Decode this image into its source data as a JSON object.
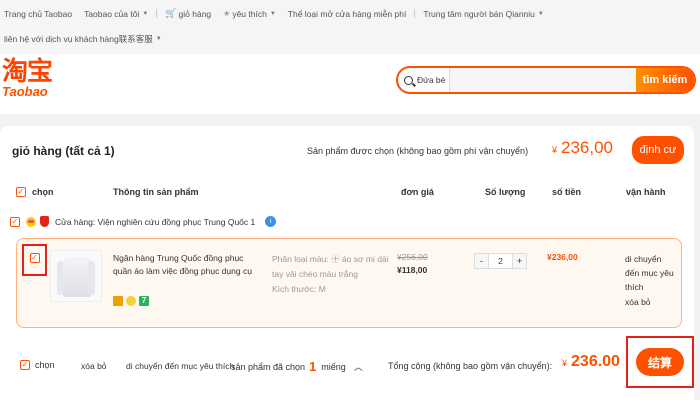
{
  "nav": {
    "row1": [
      {
        "label": "Trang chủ Taobao",
        "caret": false
      },
      {
        "label": "Taobao của tôi",
        "caret": true
      },
      {
        "label": "giỏ hàng",
        "caret": false,
        "icon": "cart-icon"
      },
      {
        "label": "yêu thích",
        "caret": true,
        "icon": "star-icon"
      },
      {
        "label": "Thể loại mở cửa hàng miễn phí",
        "caret": false
      },
      {
        "label": "Trung tâm người bán Qianniu",
        "caret": true
      }
    ],
    "row2": [
      {
        "label": "liên hệ với dịch vụ khách hàng联系客服",
        "caret": true
      }
    ]
  },
  "logo": {
    "cn": "淘宝",
    "en": "Taobao"
  },
  "search": {
    "category": "Đứa bé",
    "button": "tìm kiếm",
    "value": ""
  },
  "cart": {
    "title": "giỏ hàng (tất cả 1)",
    "selected_label": "Sản phẩm được chọn (không bao gồm phí vận chuyển)",
    "currency": "¥",
    "selected_total": "236,00",
    "checkout_top": "định cư",
    "columns": [
      "chọn",
      "Thông tin sản phẩm",
      "đơn giá",
      "Số lượng",
      "số tiền",
      "vận hành"
    ],
    "store": "Cửa hàng: Viện nghiên cứu đồng phục Trung Quốc 1",
    "item": {
      "name": "Ngân hàng Trung Quốc đồng phục quần áo làm việc đồng phục dụng cụ",
      "attr_color": "Phân loại màu: ㊉ áo sơ mi dài tay vải chéo màu trắng",
      "attr_size": "Kích thước: M",
      "price_old": "¥256,00",
      "price_new": "¥118,00",
      "qty": "2",
      "qty_minus": "-",
      "qty_plus": "+",
      "subtotal": "¥236,00",
      "actions": [
        "di chuyển đến mục yêu thích",
        "xóa bỏ"
      ],
      "icon_badge": "7"
    },
    "bottom": {
      "select_all": "chọn",
      "delete": "xóa bỏ",
      "move_fav": "di chuyển đến mục yêu thích",
      "count_prefix": "sản phẩm đã chọn",
      "count": "1",
      "count_suffix": "miếng",
      "total_label": "Tổng cộng (không bao gồm vận chuyển):",
      "total": "236.00",
      "checkout": "结算"
    }
  },
  "colors": {
    "accent": "#ff5000",
    "highlight_box": "#e2231a"
  }
}
